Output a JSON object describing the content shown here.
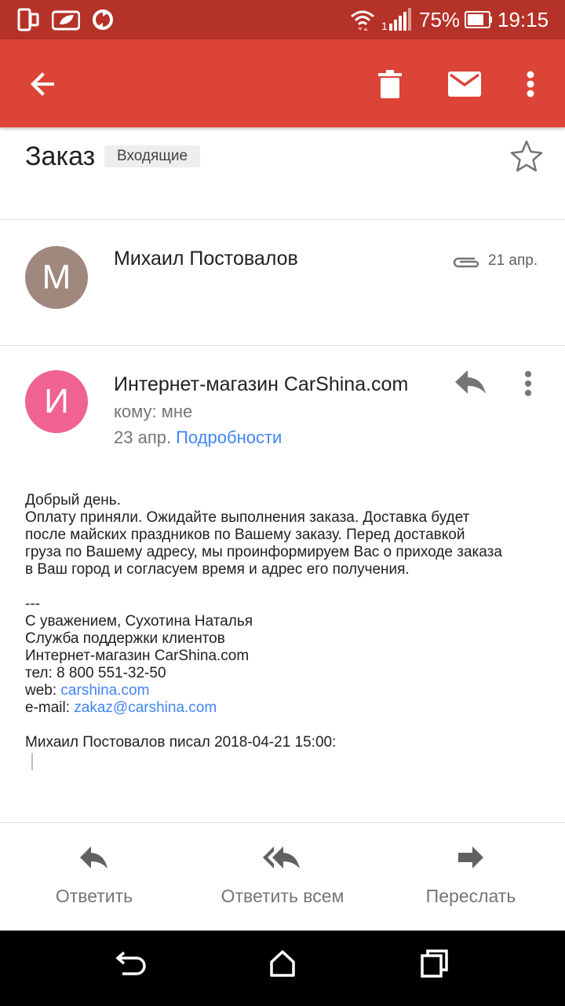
{
  "status_bar": {
    "battery_percent": "75%",
    "time": "19:15",
    "icons": [
      "phone-outline-icon",
      "leaf-notification-icon",
      "sync-icon",
      "wifi-icon",
      "signal-icon",
      "battery-icon"
    ]
  },
  "app_bar": {
    "icons": [
      "back-arrow-icon",
      "delete-icon",
      "mark-unread-icon",
      "more-vert-icon"
    ]
  },
  "thread": {
    "subject": "Заказ",
    "label": "Входящие"
  },
  "messages": [
    {
      "avatar_letter": "М",
      "avatar_color": "#a1887f",
      "sender": "Михаил Постовалов",
      "date": "21 апр.",
      "has_attachment": true
    },
    {
      "avatar_letter": "И",
      "avatar_color": "#f06292",
      "sender": "Интернет-магазин CarShina.com",
      "recipient_line": "кому: мне",
      "date": "23 апр.",
      "details_label": "Подробности"
    }
  ],
  "body": {
    "greeting": "Добрый день.",
    "paragraph_lines": [
      "Оплату приняли. Ожидайте выполнения заказа. Доставка будет",
      "после майских праздников по Вашему заказу. Перед доставкой",
      "груза по Вашему адресу, мы проинформируем Вас о приходе заказа",
      "в Ваш город и согласуем время и адрес его получения."
    ],
    "separator": "---",
    "signature": [
      "С уважением, Сухотина Наталья",
      "Служба поддержки клиентов",
      "Интернет-магазин CarShina.com",
      "тел: 8 800 551-32-50"
    ],
    "web_label": "web:",
    "web_link": "carshina.com",
    "email_label": "e-mail:",
    "email_link": "zakaz@carshina.com",
    "quote_intro": "Михаил Постовалов писал 2018-04-21 15:00:"
  },
  "actions": {
    "reply": "Ответить",
    "reply_all": "Ответить всем",
    "forward": "Переслать"
  },
  "colors": {
    "app_bar": "#db4437",
    "status_bar": "#b53228",
    "link": "#4285f4"
  }
}
